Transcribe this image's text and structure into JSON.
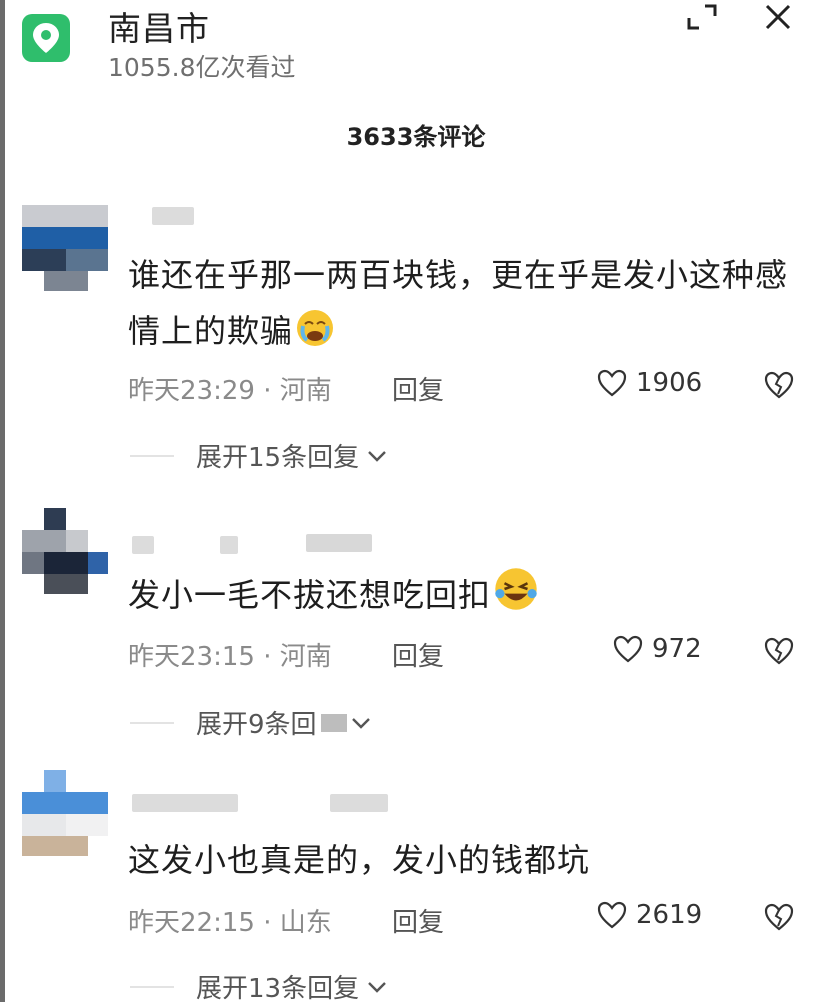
{
  "header": {
    "location_name": "南昌市",
    "views": "1055.8亿次看过",
    "location_icon": "location-pin-icon",
    "minimize_icon": "minimize-icon",
    "close_icon": "close-icon",
    "accent": "#2fbe6c"
  },
  "comments_title": "3633条评论",
  "comments": [
    {
      "text": "谁还在乎那一两百块钱，更在乎是发小这种感情上的欺骗",
      "emoji": "crying-emoji",
      "time": "昨天23:29",
      "sep": "·",
      "region": "河南",
      "reply_label": "回复",
      "likes": "1906",
      "expand": "展开15条回复"
    },
    {
      "text": "发小一毛不拔还想吃回扣",
      "emoji": "laughing-tears-emoji",
      "time": "昨天23:15",
      "sep": "·",
      "region": "河南",
      "reply_label": "回复",
      "likes": "972",
      "expand": "展开9条回"
    },
    {
      "text": "这发小也真是的，发小的钱都坑",
      "time": "昨天22:15",
      "sep": "·",
      "region": "山东",
      "reply_label": "回复",
      "likes": "2619",
      "expand": "展开13条回复"
    }
  ]
}
